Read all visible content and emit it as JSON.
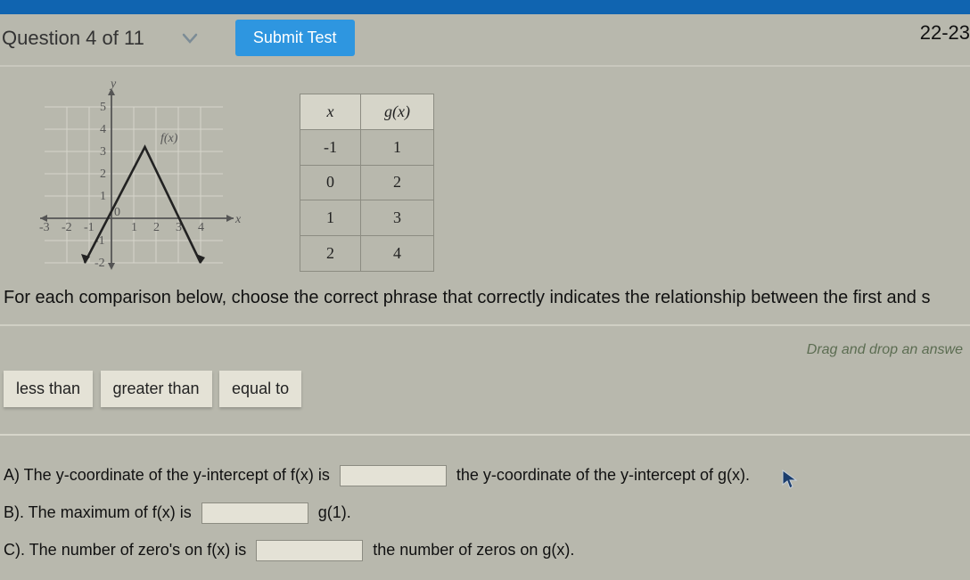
{
  "header": {
    "question_counter": "Question 4 of 11",
    "submit_label": "Submit Test",
    "right_label": "22-23"
  },
  "graph": {
    "function_label": "f(x)",
    "x_axis_label": "x",
    "y_axis_label": "y",
    "y_ticks": [
      "5",
      "4",
      "3",
      "2",
      "1"
    ],
    "y_ticks_neg": [
      "-1",
      "-2"
    ],
    "x_ticks_neg": [
      "-3",
      "-2",
      "-1"
    ],
    "x_ticks_pos": [
      "1",
      "2",
      "3",
      "4"
    ],
    "origin": "0"
  },
  "table": {
    "head_x": "x",
    "head_g": "g(x)",
    "rows": [
      {
        "x": "-1",
        "g": "1"
      },
      {
        "x": "0",
        "g": "2"
      },
      {
        "x": "1",
        "g": "3"
      },
      {
        "x": "2",
        "g": "4"
      }
    ]
  },
  "prompt_text": "For each comparison below, choose the correct phrase that correctly indicates the relationship between the first and s",
  "hint_text": "Drag and drop an answe",
  "chips": {
    "c1": "less than",
    "c2": "greater than",
    "c3": "equal to"
  },
  "items": {
    "A_pre": "A) The y-coordinate of the y-intercept of f(x) is",
    "A_post": "the y-coordinate of the y-intercept of g(x).",
    "B_pre": "B). The maximum of f(x) is",
    "B_post": "g(1).",
    "C_pre": "C). The number of zero's on f(x) is",
    "C_post": "the number of zeros on g(x)."
  },
  "chart_data": {
    "type": "line",
    "title": "",
    "xlabel": "x",
    "ylabel": "y",
    "xlim": [
      -3,
      4
    ],
    "ylim": [
      -2,
      5
    ],
    "series": [
      {
        "name": "f(x)",
        "x": [
          -1.2,
          1.5,
          4
        ],
        "y": [
          -2,
          3.2,
          -2
        ]
      }
    ]
  }
}
